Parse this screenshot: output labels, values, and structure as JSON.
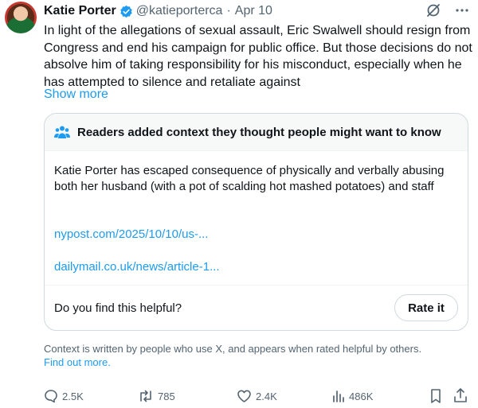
{
  "tweet": {
    "author_name": "Katie Porter",
    "handle": "@katieporterca",
    "separator": "·",
    "date": "Apr 10",
    "text": "In light of the allegations of sexual assault, Eric Swalwell should resign from Congress and end his campaign for public office. But those decisions do not absolve him of taking responsibility for his misconduct, especially when he has attempted to silence and retaliate against",
    "show_more": "Show more"
  },
  "community_note": {
    "heading": "Readers added context they thought people might want to know",
    "body": "Katie Porter has escaped consequence of physically and verbally abusing both her husband (with a pot of scalding hot mashed potatoes) and staff",
    "links": [
      "nypost.com/2025/10/10/us-...",
      "dailymail.co.uk/news/article-1..."
    ],
    "helpful_question": "Do you find this helpful?",
    "rate_button": "Rate it"
  },
  "footnote": {
    "text": "Context is written by people who use X, and appears when rated helpful by others.",
    "link": "Find out more."
  },
  "actions": {
    "replies": "2.5K",
    "reposts": "785",
    "likes": "2.4K",
    "views": "486K"
  },
  "colors": {
    "accent": "#1d9bf0",
    "text_secondary": "#536471",
    "border": "#cfd9de",
    "note_header_bg": "#f7f9f9"
  },
  "icons": [
    "verified-badge-icon",
    "grok-icon",
    "more-icon",
    "people-icon",
    "reply-icon",
    "repost-icon",
    "like-icon",
    "views-icon",
    "bookmark-icon",
    "share-icon"
  ]
}
